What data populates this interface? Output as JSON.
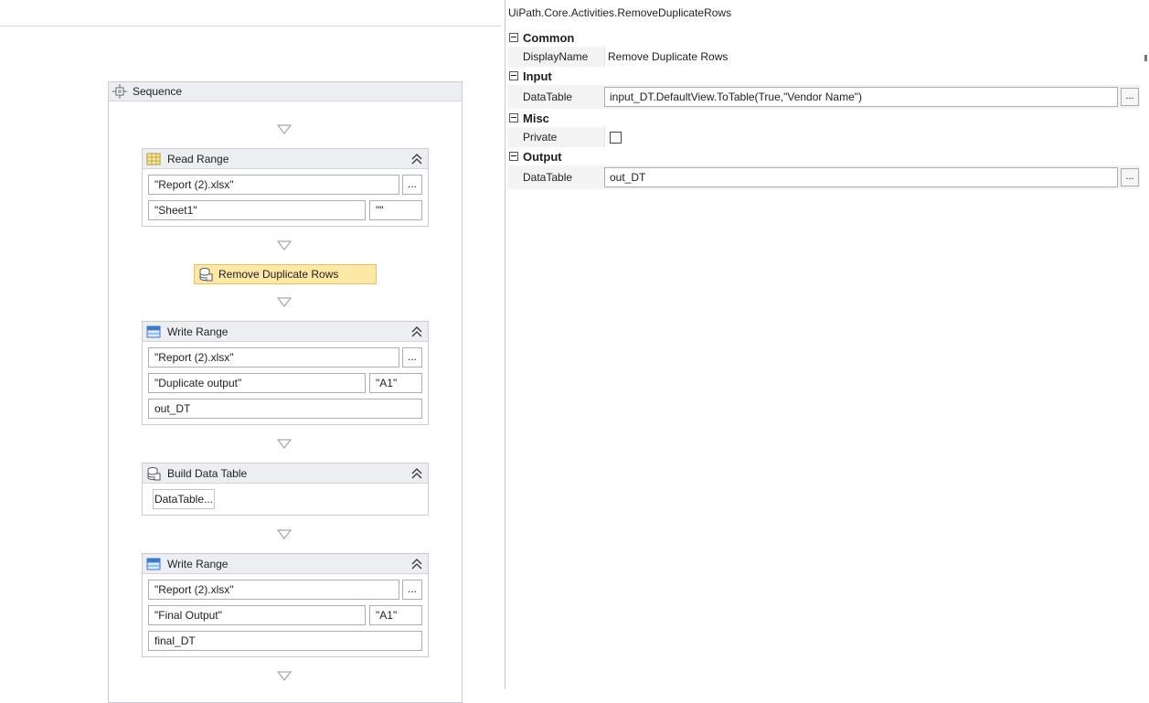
{
  "designer": {
    "sequence": {
      "title": "Sequence",
      "icon": "sequence-icon"
    },
    "read_range": {
      "title": "Read Range",
      "icon": "excel-read-icon",
      "workbook": "\"Report (2).xlsx\"",
      "sheet": "\"Sheet1\"",
      "range": "\"\"",
      "browse": "..."
    },
    "remove_duplicate_rows": {
      "title": "Remove Duplicate Rows",
      "icon": "datatable-icon"
    },
    "write_range_1": {
      "title": "Write Range",
      "icon": "excel-write-icon",
      "workbook": "\"Report (2).xlsx\"",
      "sheet": "\"Duplicate output\"",
      "cell": "\"A1\"",
      "datatable": "out_DT",
      "browse": "..."
    },
    "build_data_table": {
      "title": "Build Data Table",
      "icon": "datatable-icon",
      "button": "DataTable..."
    },
    "write_range_2": {
      "title": "Write Range",
      "icon": "excel-write-icon",
      "workbook": "\"Report (2).xlsx\"",
      "sheet": "\"Final Output\"",
      "cell": "\"A1\"",
      "datatable": "final_DT",
      "browse": "..."
    }
  },
  "properties": {
    "title": "UiPath.Core.Activities.RemoveDuplicateRows",
    "categories": {
      "common": {
        "label": "Common",
        "display_name_label": "DisplayName",
        "display_name_value": "Remove Duplicate Rows"
      },
      "input": {
        "label": "Input",
        "datatable_label": "DataTable",
        "datatable_value": "input_DT.DefaultView.ToTable(True,\"Vendor Name\")",
        "browse": "..."
      },
      "misc": {
        "label": "Misc",
        "private_label": "Private",
        "private_checked": false
      },
      "output": {
        "label": "Output",
        "datatable_label": "DataTable",
        "datatable_value": "out_DT",
        "browse": "..."
      }
    }
  },
  "colors": {
    "selected_activity": "#fde8a6",
    "header_bg": "#eceef1",
    "excel_green": "#1f7a3c",
    "table_blue": "#3e7cc4"
  }
}
